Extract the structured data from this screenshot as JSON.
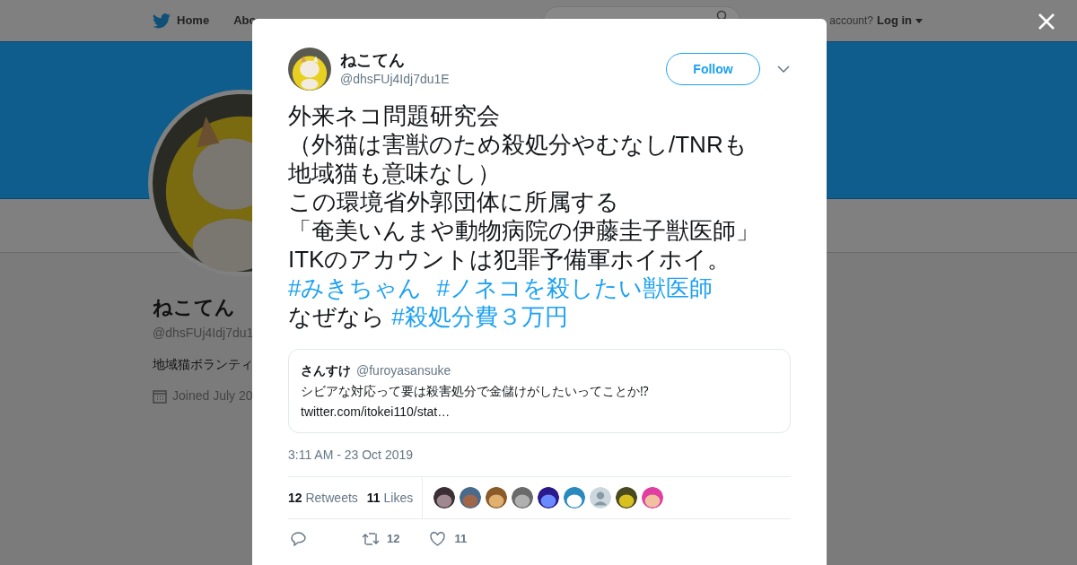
{
  "header": {
    "nav": [
      {
        "label": "Home"
      },
      {
        "label": "Abo"
      }
    ],
    "account_prompt": "account?",
    "login": "Log in"
  },
  "profile": {
    "name": "ねこてん",
    "handle": "@dhsFUj4Idj7du1",
    "bio": "地域猫ボランティ",
    "joined": "Joined July 20"
  },
  "tweet": {
    "name": "ねこてん",
    "handle": "@dhsFUj4Idj7du1E",
    "follow": "Follow",
    "lines": [
      [
        {
          "kind": "text",
          "text": "外来ネコ問題研究会"
        }
      ],
      [
        {
          "kind": "text",
          "text": "（外猫は害獣のため殺処分やむなし/TNRも"
        }
      ],
      [
        {
          "kind": "text",
          "text": "地域猫も意味なし）"
        }
      ],
      [
        {
          "kind": "text",
          "text": "この環境省外郭団体に所属する"
        }
      ],
      [
        {
          "kind": "text",
          "text": "「奄美いんまや動物病院の伊藤圭子獣医師」"
        }
      ],
      [
        {
          "kind": "text",
          "text": "ITKのアカウントは犯罪予備軍ホイホイ。"
        }
      ],
      [
        {
          "kind": "hashtag",
          "text": "#みきちゃん"
        },
        {
          "kind": "hashtag",
          "text": "#ノネコを殺したい獣医師"
        }
      ],
      [
        {
          "kind": "text",
          "text": "なぜなら "
        },
        {
          "kind": "hashtag",
          "text": "#殺処分費３万円"
        }
      ]
    ],
    "quote": {
      "name": "さんすけ",
      "handle": "@furoyasansuke",
      "text": "シビアな対応って要は殺害処分で金儲けがしたいってことか⁉",
      "link": "twitter.com/itokei110/stat…"
    },
    "time": "3:11 AM - 23 Oct 2019",
    "retweets": "12",
    "retweets_label": "Retweets",
    "likes": "11",
    "likes_label": "Likes",
    "likers": [
      {
        "kind": "picture"
      },
      {
        "kind": "picture"
      },
      {
        "kind": "picture"
      },
      {
        "kind": "picture"
      },
      {
        "kind": "picture"
      },
      {
        "kind": "picture"
      },
      {
        "kind": "default"
      },
      {
        "kind": "picture"
      },
      {
        "kind": "picture"
      }
    ],
    "actions": {
      "retweet_count": "12",
      "like_count": "11"
    }
  }
}
